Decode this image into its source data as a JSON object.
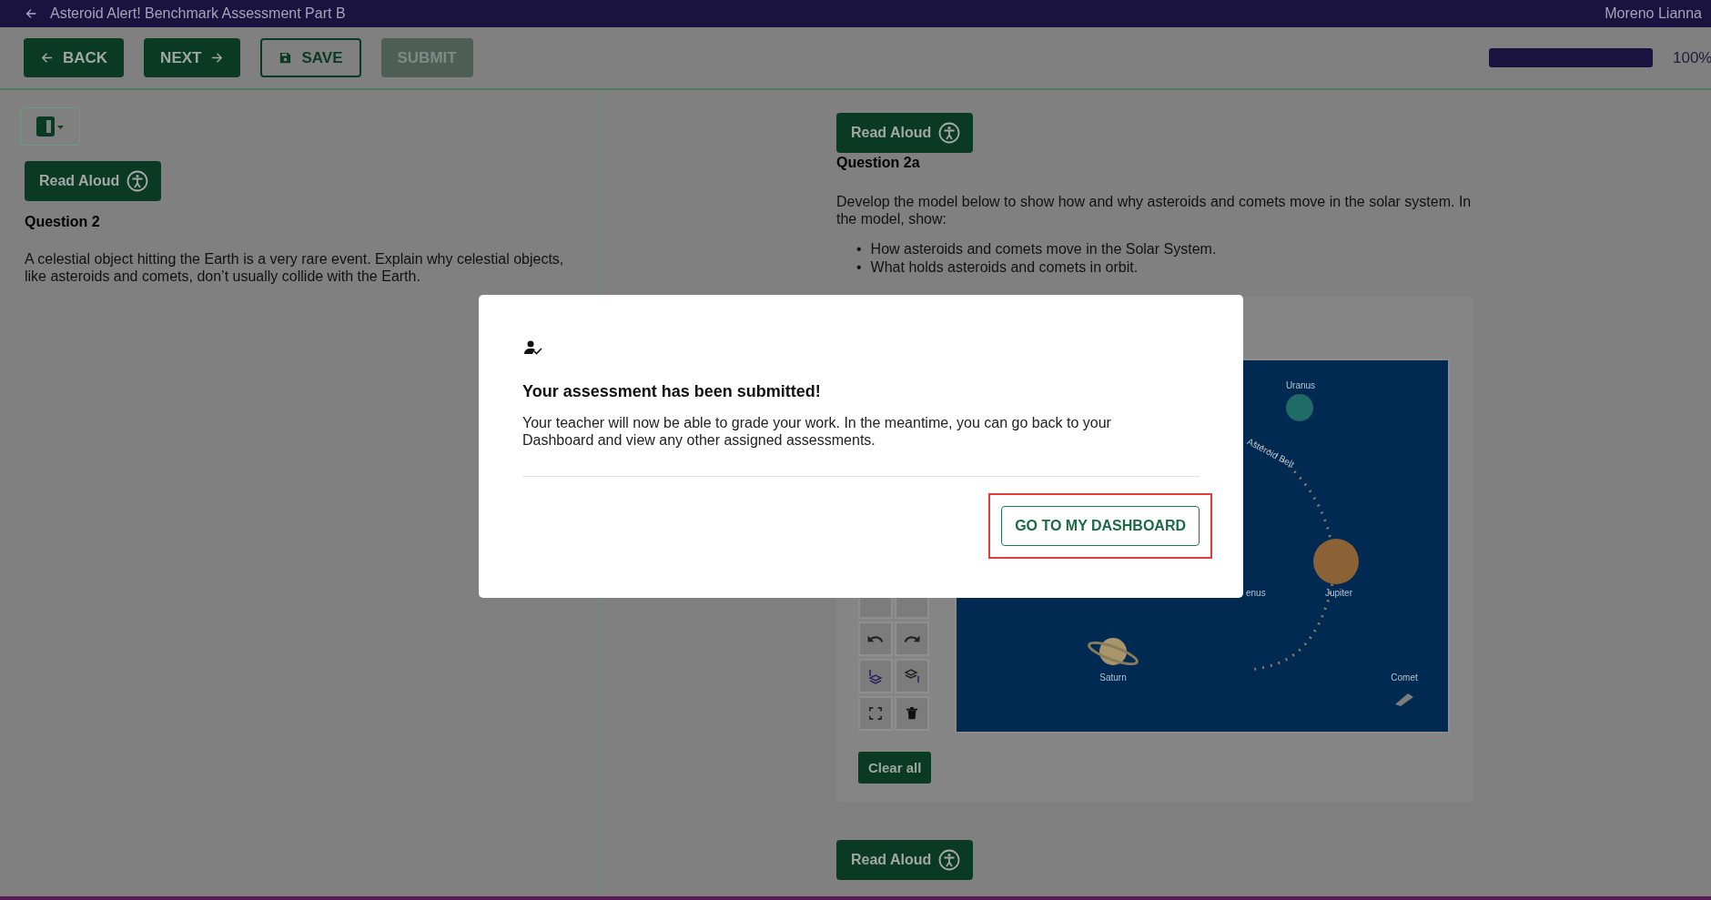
{
  "header": {
    "title": "Asteroid Alert! Benchmark Assessment Part B",
    "user": "Moreno Lianna"
  },
  "toolbar": {
    "buttons": [
      {
        "label": "BACK",
        "kind": "back",
        "disabled": false
      },
      {
        "label": "NEXT",
        "kind": "next",
        "disabled": false
      },
      {
        "label": "SAVE",
        "kind": "save",
        "disabled": false
      },
      {
        "label": "SUBMIT",
        "kind": "submit",
        "disabled": true
      }
    ],
    "progress": {
      "level": 1,
      "reading": "100%"
    }
  },
  "left_panel": {
    "read_aloud": "Read Aloud",
    "question_title": "Question 2",
    "question_text": "A celestial object hitting the Earth is a very rare event. Explain why celestial objects, like asteroids and comets, don’t usually collide with the Earth."
  },
  "right_panel": {
    "read_aloud": "Read Aloud",
    "question_title": "Question 2a",
    "question_text": "Develop the model below to show how and why asteroids and comets move in the solar system. In the model, show:",
    "bullets": [
      {
        "marker": "•",
        "text": "How asteroids and comets move in the Solar System."
      },
      {
        "marker": "•",
        "text": "What holds asteroids and comets in orbit."
      }
    ],
    "diagram_labels": [
      "Uranus",
      "Asteroid Belt",
      "enus",
      "Jupiter",
      "Saturn",
      "Comet"
    ],
    "clear_button": "Clear all",
    "read_aloud_2": "Read Aloud"
  },
  "dialog": {
    "title": "Your assessment has been submitted!",
    "message": "Your teacher will now be able to grade your work. In the meantime, you can go back to your Dashboard and view any other assigned assessments.",
    "button": "GO TO MY DASHBOARD",
    "highlighted": true
  }
}
